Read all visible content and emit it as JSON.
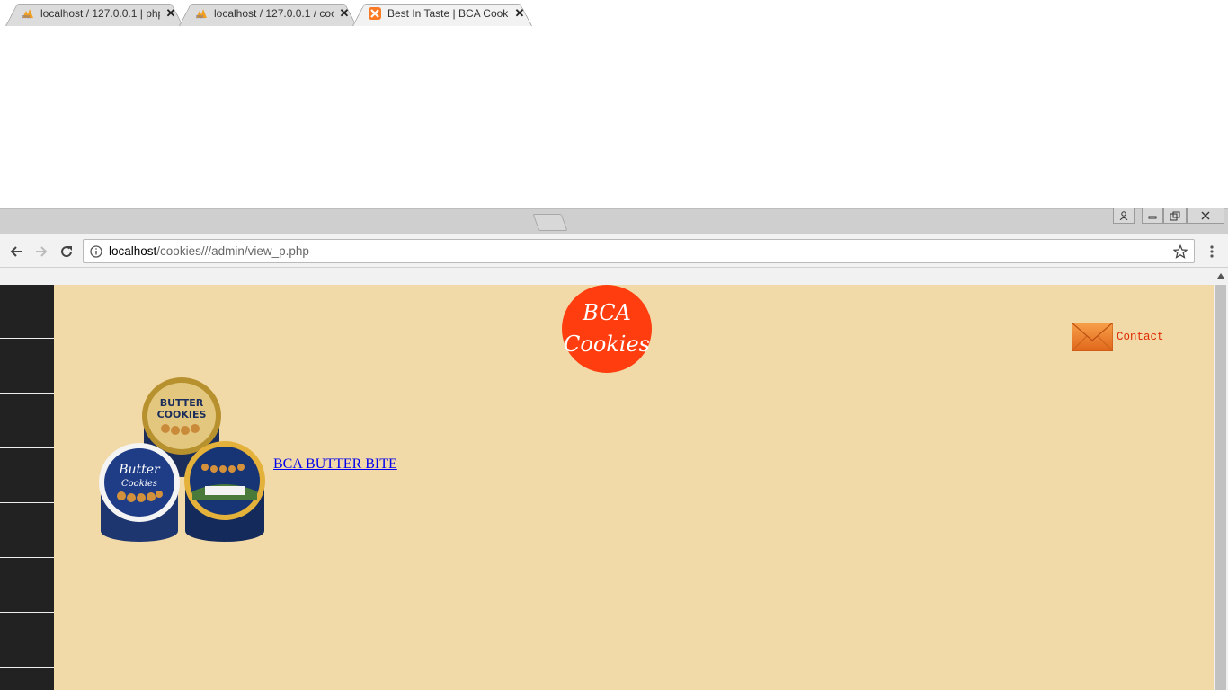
{
  "browser": {
    "tabs": [
      {
        "title": "localhost / 127.0.0.1 | php",
        "icon": "phpmyadmin-icon",
        "active": false
      },
      {
        "title": "localhost / 127.0.0.1 / coo",
        "icon": "phpmyadmin-icon",
        "active": false
      },
      {
        "title": "Best In Taste | BCA Cooki",
        "icon": "xampp-icon",
        "active": true
      }
    ],
    "address": {
      "host": "localhost",
      "path": "/cookies///admin/view_p.php"
    }
  },
  "page": {
    "logo": {
      "line1": "BCA",
      "line2": "Cookies",
      "color": "#ff3d0f"
    },
    "contact_label": "Contact",
    "product": {
      "link_text": "BCA BUTTER BITE",
      "image_icon": "butter-cookies-tins-image"
    },
    "colors": {
      "background": "#f1d9a8",
      "sidebar": "#222222",
      "contact_text": "#e02a00"
    }
  }
}
